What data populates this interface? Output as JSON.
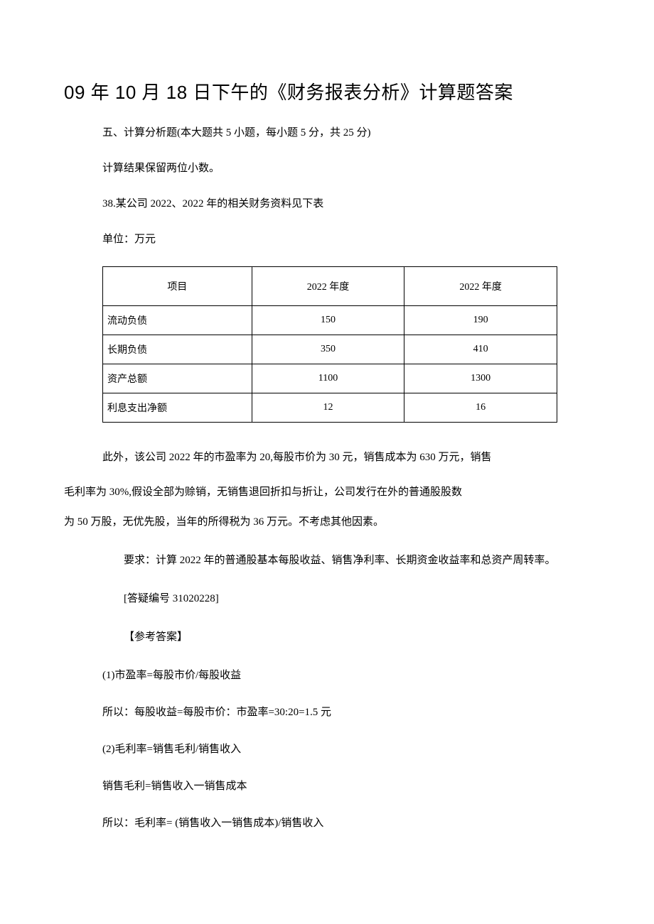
{
  "title_prefix": "09 年 10 月 18 日下午的《财务报表分析》计算题答案",
  "section_heading": "五、计算分析题(本大题共 5 小题，每小题 5 分，共 25 分)",
  "precision_note": "计算结果保留两位小数。",
  "question_intro": "38.某公司 2022、2022 年的相关财务资料见下表",
  "unit_label": "单位：万元",
  "table": {
    "headers": [
      "项目",
      "2022 年度",
      "2022 年度"
    ],
    "rows": [
      {
        "label": "流动负债",
        "col1": "150",
        "col2": "190"
      },
      {
        "label": "长期负债",
        "col1": "350",
        "col2": "410"
      },
      {
        "label": "资产总额",
        "col1": "1100",
        "col2": "1300"
      },
      {
        "label": "利息支出净额",
        "col1": "12",
        "col2": "16"
      }
    ]
  },
  "para1": "此外，该公司 2022 年的市盈率为 20,每股市价为 30 元，销售成本为 630 万元，销售",
  "para2": "毛利率为 30%,假设全部为赊销，无销售退回折扣与折让，公司发行在外的普通股股数",
  "para3": "为 50 万股，无优先股，当年的所得税为 36 万元。不考虑其他因素。",
  "requirement": "要求：计算 2022 年的普通股基本每股收益、销售净利率、长期资金收益率和总资产周转率。",
  "ref_num": "[答疑编号 31020228]",
  "answer_label": "【参考答案】",
  "answer_lines": [
    "(1)市盈率=每股市价/每股收益",
    "所以：每股收益=每股市价：市盈率=30:20=1.5 元",
    "(2)毛利率=销售毛利/销售收入",
    "销售毛利=销售收入一销售成本",
    "所以：毛利率= (销售收入一销售成本)/销售收入"
  ]
}
